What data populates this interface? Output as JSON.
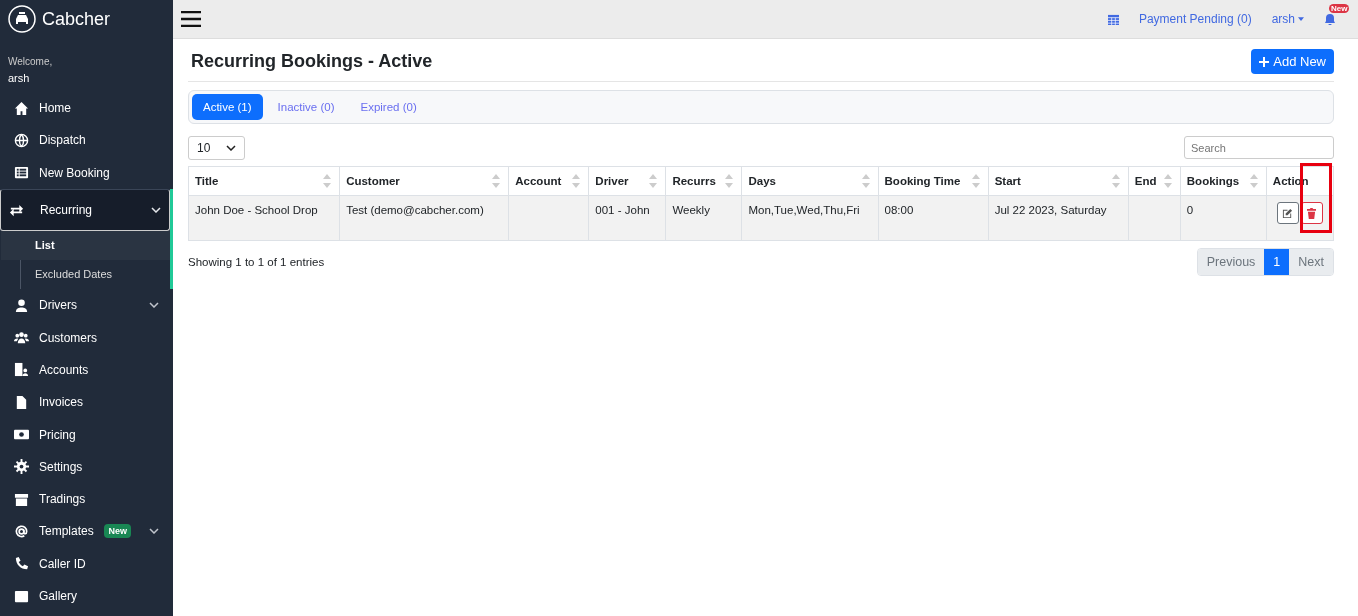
{
  "brand": {
    "name": "Cabcher"
  },
  "welcome": {
    "greeting": "Welcome,",
    "user": "arsh"
  },
  "sidebar": {
    "items": [
      {
        "label": "Home",
        "selected": false
      },
      {
        "label": "Dispatch",
        "selected": false
      },
      {
        "label": "New Booking",
        "selected": false
      },
      {
        "label": "Recurring",
        "selected": true,
        "expanded": true,
        "has_children": true,
        "children": [
          {
            "label": "List",
            "selected": true
          },
          {
            "label": "Excluded Dates",
            "selected": false
          }
        ]
      },
      {
        "label": "Drivers",
        "selected": false,
        "expanded": false,
        "has_children": true
      },
      {
        "label": "Customers",
        "selected": false
      },
      {
        "label": "Accounts",
        "selected": false
      },
      {
        "label": "Invoices",
        "selected": false
      },
      {
        "label": "Pricing",
        "selected": false
      },
      {
        "label": "Settings",
        "selected": false
      },
      {
        "label": "Tradings",
        "selected": false
      },
      {
        "label": "Templates",
        "selected": false,
        "expanded": false,
        "has_children": true,
        "badge": "New"
      },
      {
        "label": "Caller ID",
        "selected": false
      },
      {
        "label": "Gallery",
        "selected": false
      }
    ]
  },
  "topbar": {
    "payment_link": "Payment Pending (0)",
    "user": "arsh",
    "notification_badge": "New"
  },
  "page": {
    "title": "Recurring Bookings - Active",
    "add_button": "Add New"
  },
  "tabs": [
    {
      "label": "Active (1)",
      "selected": true
    },
    {
      "label": "Inactive (0)",
      "selected": false
    },
    {
      "label": "Expired (0)",
      "selected": false
    }
  ],
  "page_size": {
    "value": "10"
  },
  "search": {
    "placeholder": "Search"
  },
  "table": {
    "columns": [
      "Title",
      "Customer",
      "Account",
      "Driver",
      "Recurrs",
      "Days",
      "Booking Time",
      "Start",
      "End",
      "Bookings",
      "Action"
    ],
    "rows": [
      {
        "cells": [
          "John Doe - School Drop",
          "Test (demo@cabcher.com)",
          "",
          "001 - John",
          "Weekly",
          "Mon,Tue,Wed,Thu,Fri",
          "08:00",
          "Jul 22 2023, Saturday",
          "",
          "0"
        ],
        "delete_highlighted": true
      }
    ]
  },
  "footer": {
    "info": "Showing 1 to 1 of 1 entries"
  },
  "pagination": {
    "previous": "Previous",
    "next": "Next",
    "pages": [
      {
        "label": "1",
        "selected": true
      }
    ]
  }
}
